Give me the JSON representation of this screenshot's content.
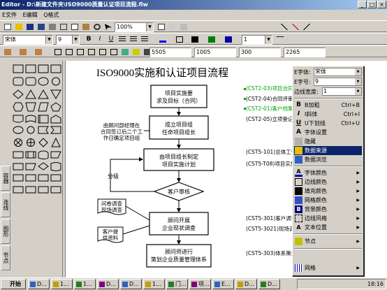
{
  "window": {
    "title": "Editor - D:\\新建文件夹\\ISO9000质量认证项目流程.flw"
  },
  "menu": {
    "items": [
      "E文件",
      "E编辑",
      "Q格式"
    ]
  },
  "toolbar1": {
    "zoom": "100%"
  },
  "toolbar2": {
    "font": "宋体",
    "size": "9",
    "line_width": "1"
  },
  "toolbar3": {
    "x": "5505",
    "y": "1005",
    "w": "300",
    "h": "2265"
  },
  "side_tabs": [
    "节点",
    "图形",
    "连线",
    "容器"
  ],
  "diagram": {
    "title": "ISO9000实施和认证项目流程",
    "boxes": [
      "项目实施要\n求及目标（合同）",
      "成立项目组\n任命项目组长",
      "由项目组长制定\n项目实施计划",
      "顾问开展\n企业现状调查",
      "顾问师进行\n策划企业质量管理体系"
    ],
    "decision": "客户审核",
    "split_label": "分级",
    "side_note": "由顾问部经理在\n合同签订后二个工\n作日确定项目组",
    "docs": [
      "问卷调查\n现场调查",
      "客户提\n供资料"
    ],
    "annotations": [
      "(CST2-03)项目合同",
      "(CST2-04)合同评审",
      "(CST2-01)客户档案",
      "(CST2-05)立项登记",
      "(CST5-101)总体工作计划",
      "(CST5-T08)项目实施计划",
      "(CST5-301)客户调查",
      "(CST5-3021)现场调查",
      "(CST5-303)体系策划"
    ]
  },
  "context_menu": {
    "font_label": "E字体:",
    "font_value": "宋体",
    "size_label": "E字号:",
    "size_value": "9",
    "border_label": "边线宽度:",
    "border_value": "1",
    "items": [
      {
        "label": "B加粗",
        "shortcut": "Ctrl+B"
      },
      {
        "label": "I斜体",
        "shortcut": "Ctrl+I"
      },
      {
        "label": "U下划线",
        "shortcut": "Ctrl+U"
      },
      {
        "label": "字体设置",
        "shortcut": ""
      },
      {
        "label": "隐藏",
        "shortcut": ""
      },
      {
        "label": "数据来源",
        "shortcut": ""
      },
      {
        "label": "数据浏览",
        "shortcut": ""
      },
      {
        "label": "字体颜色",
        "shortcut": ""
      },
      {
        "label": "边线颜色",
        "shortcut": ""
      },
      {
        "label": "填充颜色",
        "shortcut": ""
      },
      {
        "label": "网格颜色",
        "shortcut": ""
      },
      {
        "label": "背景颜色",
        "shortcut": ""
      },
      {
        "label": "边线风格",
        "shortcut": ""
      },
      {
        "label": "文本位置",
        "shortcut": ""
      },
      {
        "label": "节点",
        "shortcut": ""
      },
      {
        "label": "网格",
        "shortcut": ""
      }
    ]
  },
  "taskbar": {
    "start": "开始",
    "tasks": [
      "D...",
      "1...",
      "1...",
      "D...",
      "D...",
      "1...",
      "门...",
      "项...",
      "E...",
      "D...",
      "D..."
    ],
    "clock": "18:16"
  }
}
